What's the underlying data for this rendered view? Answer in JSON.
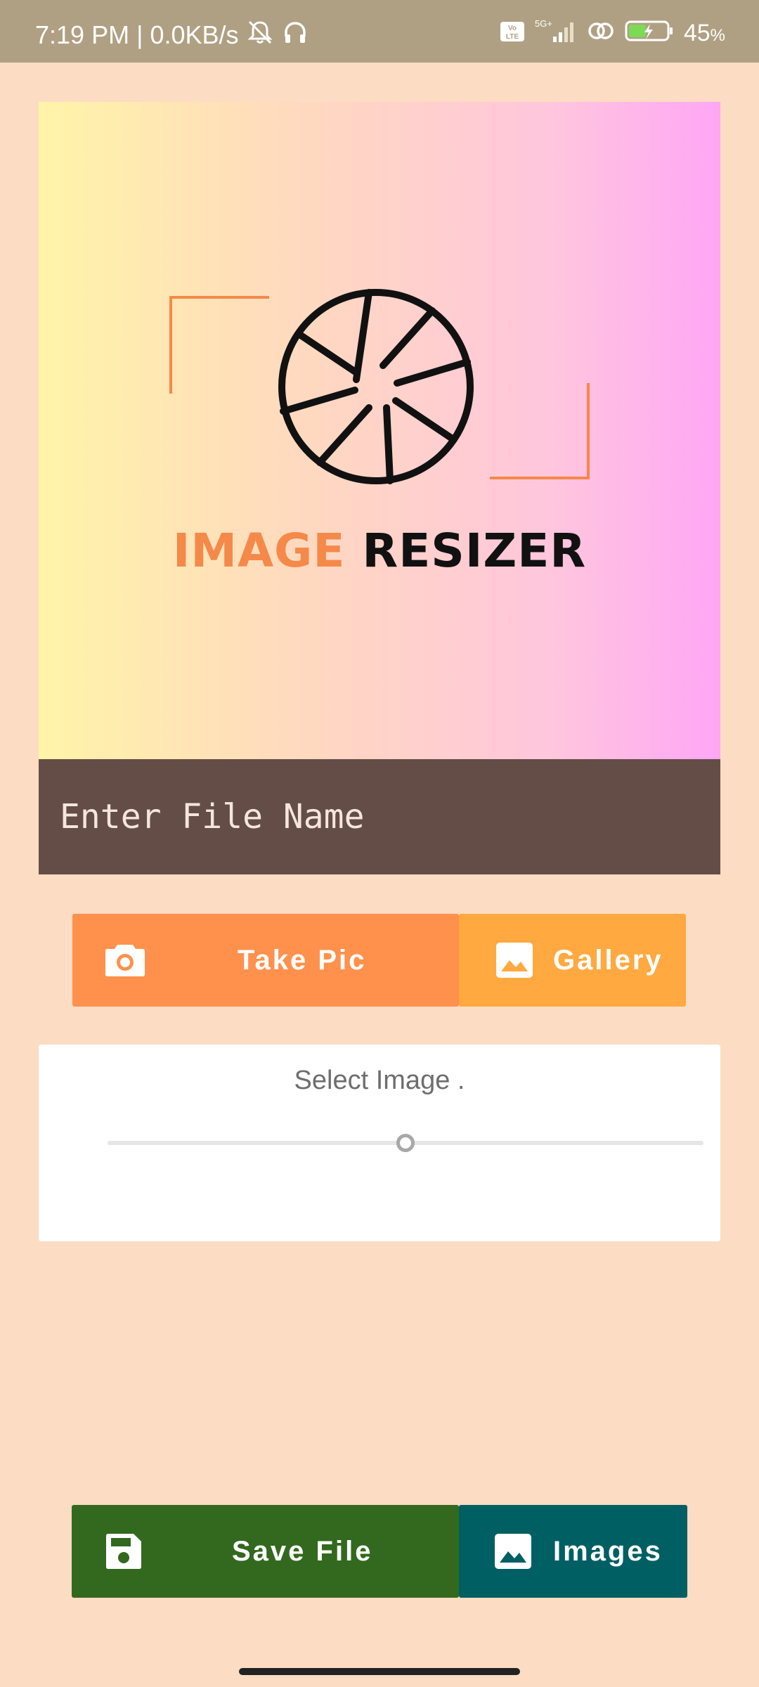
{
  "status_bar": {
    "time": "7:19 PM",
    "network_speed": "0.0KB/s",
    "battery_level": "45",
    "battery_unit": "%",
    "volte_label": "Vo LTE",
    "network_type": "5G+"
  },
  "hero": {
    "logo_word1": "IMAGE",
    "logo_word2": "RESIZER",
    "icon": "camera-aperture-icon"
  },
  "file_name": {
    "placeholder": "Enter File Name",
    "value": ""
  },
  "actions": {
    "take_pic_label": "Take Pic",
    "take_pic_icon": "camera-icon",
    "gallery_label": "Gallery",
    "gallery_icon": "image-icon"
  },
  "resize_card": {
    "title": "Select Image .",
    "slider_value_fraction": 0.5
  },
  "footer": {
    "save_label": "Save File",
    "save_icon": "save-icon",
    "images_label": "Images",
    "images_icon": "image-icon"
  },
  "colors": {
    "background": "#FCDCC3",
    "status_bar": "#B0A083",
    "take_pic": "#FF914D",
    "gallery": "#FFA940",
    "save": "#33691E",
    "images": "#005F63",
    "input_bg": "#654D47"
  }
}
